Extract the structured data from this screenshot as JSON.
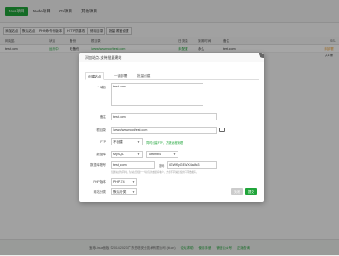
{
  "topbar": {
    "tabs": [
      "Java项目",
      "Node项目",
      "Go项目",
      "其他项目"
    ]
  },
  "toolbar": {
    "buttons": [
      "添加站点",
      "默认站点",
      "PHP命令行版本",
      "HTTP防篡改",
      "修改目录",
      "批量 覆盖设置"
    ]
  },
  "table": {
    "headers": [
      "网站名",
      "状态",
      "备份",
      "根目录",
      "日流量",
      "到期时间",
      "备注",
      "SSL"
    ],
    "row": [
      "test.com",
      "运行中",
      "无备份",
      "/www/wwwroot/test.com",
      "未配置",
      "永久",
      "test.com",
      "未部署"
    ]
  },
  "pager": {
    "summary": "共1条"
  },
  "footer": {
    "text": "宝塔Linux面板 ©2014-2023 广东堡塔安全技术有限公司 (bt.cn)",
    "links": [
      "论坛求助",
      "使用手册",
      "微信公众号",
      "正版查询"
    ]
  },
  "modal": {
    "title": "添加站点-支持批量建站",
    "tabs": [
      "创建站点",
      "一键部署",
      "批量创建"
    ],
    "domain_label": "域名",
    "domain_value": "test.com",
    "remark_label": "备注",
    "remark_value": "test.com",
    "root_label": "根目录",
    "root_value": "/www/wwwroot/test.com",
    "ftp_label": "FTP",
    "ftp_value": "不创建",
    "ftp_hint": "同时创建FTP，方便远程管理",
    "db_label": "数据库",
    "db_type": "MySQL",
    "db_charset": "utf8mb4",
    "dbuser_label": "数据库账号",
    "db_user": "test_com",
    "db_pass_label": "密码",
    "db_pass": "iGWf5yGEWX4a4fc3",
    "db_hint": "创建站点的同时，为站点创建一个对应的数据库帐户，方便不同站点使用不同数据库。",
    "php_label": "PHP版本",
    "php_value": "PHP-74",
    "cat_label": "网站分类",
    "cat_value": "默认分类",
    "close_label": "关闭",
    "submit_label": "提交"
  }
}
